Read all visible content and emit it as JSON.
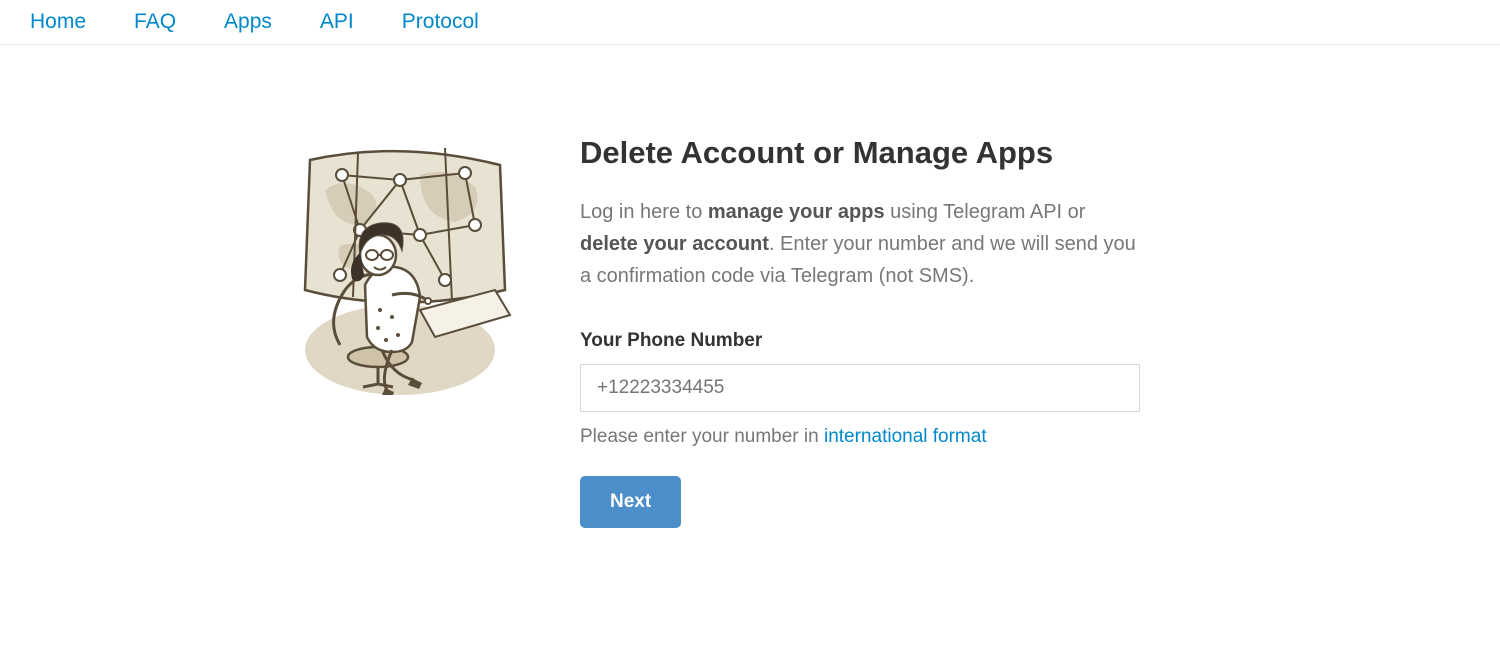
{
  "nav": {
    "items": [
      {
        "label": "Home"
      },
      {
        "label": "FAQ"
      },
      {
        "label": "Apps"
      },
      {
        "label": "API"
      },
      {
        "label": "Protocol"
      }
    ]
  },
  "main": {
    "title": "Delete Account or Manage Apps",
    "desc_prefix": "Log in here to ",
    "desc_strong1": "manage your apps",
    "desc_mid1": " using Telegram API or ",
    "desc_strong2": "delete your account",
    "desc_suffix": ". Enter your number and we will send you a confirmation code via Telegram (not SMS).",
    "phone_label": "Your Phone Number",
    "phone_placeholder": "+12223334455",
    "helper_prefix": "Please enter your number in ",
    "helper_link": "international format",
    "next_button": "Next"
  },
  "illustration": {
    "name": "telegram-assistant-illustration"
  }
}
